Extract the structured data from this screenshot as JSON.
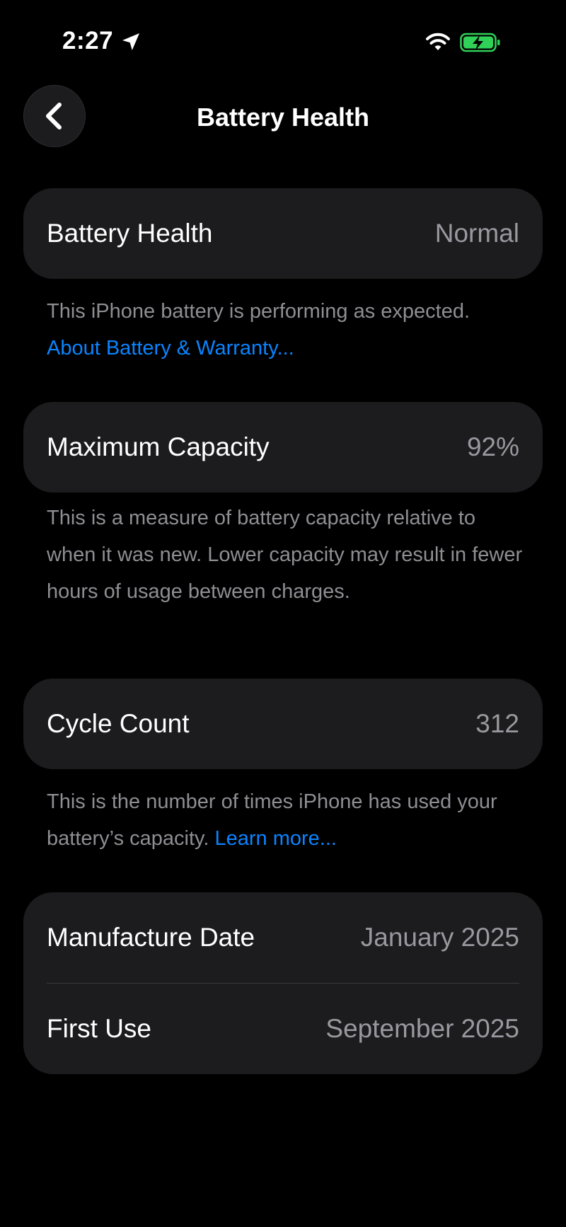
{
  "status_bar": {
    "time": "2:27",
    "icons": [
      "location-arrow-icon",
      "wifi-icon",
      "battery-charging-icon"
    ],
    "battery_color": "#30d158"
  },
  "nav": {
    "back_icon": "chevron-left-icon",
    "title": "Battery Health"
  },
  "sections": {
    "health": {
      "label": "Battery Health",
      "value": "Normal",
      "footnote_text": "This iPhone battery is performing as expected.",
      "footnote_link": "About Battery & Warranty..."
    },
    "capacity": {
      "label": "Maximum Capacity",
      "value": "92%",
      "footnote_text": "This is a measure of battery capacity relative to when it was new. Lower capacity may result in fewer hours of usage between charges."
    },
    "cycles": {
      "label": "Cycle Count",
      "value": "312",
      "footnote_text": "This is the number of times iPhone has used your battery’s capacity.",
      "footnote_link": "Learn more..."
    },
    "dates": {
      "manufacture_label": "Manufacture Date",
      "manufacture_value": "January 2025",
      "first_use_label": "First Use",
      "first_use_value": "September 2025"
    }
  },
  "colors": {
    "background": "#000000",
    "card": "#1c1c1e",
    "secondary_text": "#8e8e93",
    "link": "#0a84ff"
  }
}
